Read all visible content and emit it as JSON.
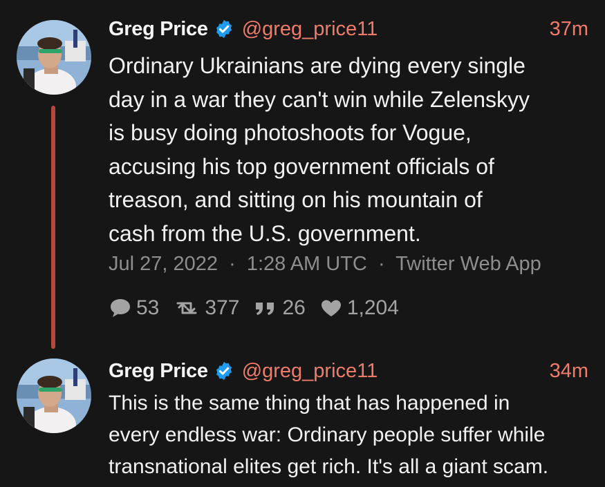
{
  "tweets": [
    {
      "author_name": "Greg Price",
      "handle": "@greg_price11",
      "time_ago": "37m",
      "text": "Ordinary Ukrainians are dying every single\nday in a war they can't win while Zelenskyy\nis busy doing photoshoots for Vogue,\naccusing his top government officials of\ntreason, and sitting on his mountain of\ncash from the U.S. government.",
      "date": "Jul 27, 2022",
      "time": "1:28 AM UTC",
      "source": "Twitter Web App",
      "separator": "·",
      "stats": {
        "replies": "53",
        "retweets": "377",
        "quotes": "26",
        "likes": "1,204"
      }
    },
    {
      "author_name": "Greg Price",
      "handle": "@greg_price11",
      "time_ago": "34m",
      "text": "This is the same thing that has happened in\nevery endless war: Ordinary people suffer while\ntransnational elites get rich. It's all a giant scam."
    }
  ],
  "icons": {
    "verified": "verified-badge-icon",
    "reply": "speech-bubble-icon",
    "retweet": "retweet-icon",
    "quote": "quote-icon",
    "like": "heart-icon"
  },
  "colors": {
    "background": "#161616",
    "accent": "#ef7c6a",
    "thread_line": "#b6473e",
    "verified": "#1d9bf0",
    "muted": "#8e8e8e"
  }
}
